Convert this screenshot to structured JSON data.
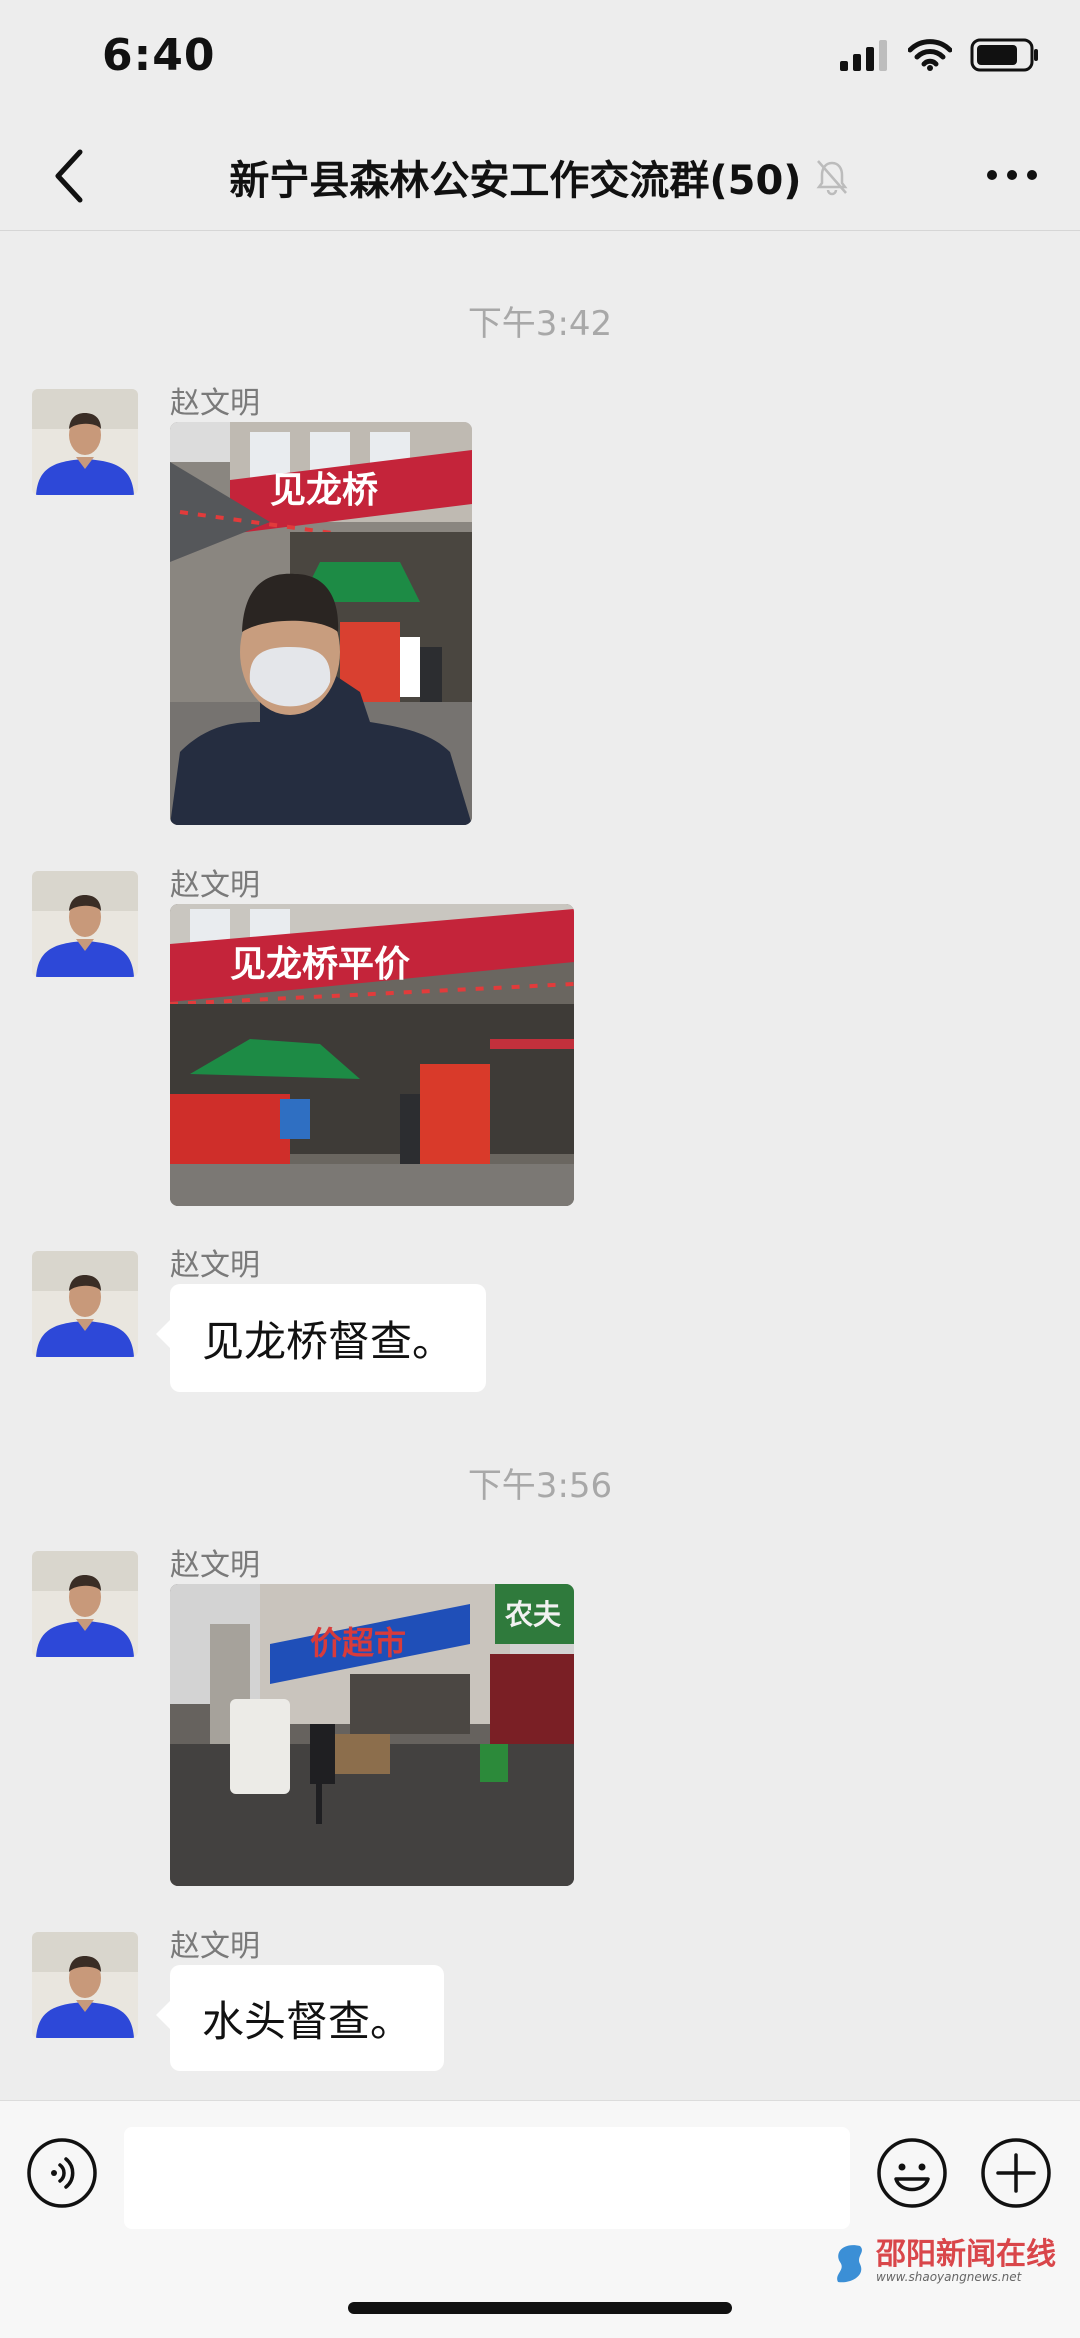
{
  "status_bar": {
    "time": "6:40"
  },
  "header": {
    "title": "新宁县森林公安工作交流群(50)"
  },
  "timestamps": [
    "下午3:42",
    "下午3:56"
  ],
  "messages": [
    {
      "sender": "赵文明",
      "type": "image",
      "image": "selfie-at-jianlongqiao-shop"
    },
    {
      "sender": "赵文明",
      "type": "image",
      "image": "jianlongqiao-pingjia-storefront"
    },
    {
      "sender": "赵文明",
      "type": "text",
      "text": "见龙桥督查。"
    },
    {
      "sender": "赵文明",
      "type": "image",
      "image": "supermarket-street-scene"
    },
    {
      "sender": "赵文明",
      "type": "text",
      "text": "水头督查。"
    }
  ],
  "signs": {
    "shop1": "见龙桥",
    "shop2": "见龙桥平价",
    "supermarket": "价超市",
    "side": "农夫"
  },
  "input": {
    "placeholder": ""
  },
  "watermark": {
    "name": "邵阳新闻在线",
    "url": "www.shaoyangnews.net"
  },
  "colors": {
    "background": "#ededed",
    "bubble": "#ffffff",
    "sign_red": "#c4243a",
    "watermark_red": "#d9464a"
  }
}
